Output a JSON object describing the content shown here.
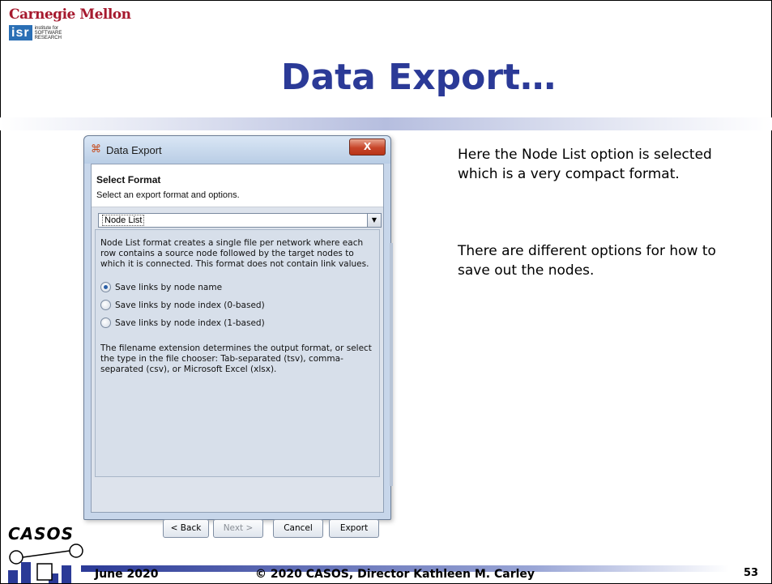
{
  "header": {
    "university": "Carnegie Mellon",
    "institute_abbr": "isr",
    "institute_line1": "institute for",
    "institute_line2": "SOFTWARE",
    "institute_line3": "RESEARCH"
  },
  "title": "Data Export…",
  "dialog": {
    "window_title": "Data Export",
    "close_label": "X",
    "heading": "Select Format",
    "subheading": "Select an export format and options.",
    "format_selected": "Node List",
    "description": "Node List format creates a single file per network where each row contains a source node followed by the target nodes to which it is connected. This format does not contain link values.",
    "options": [
      {
        "label": "Save links by node name",
        "checked": true
      },
      {
        "label": "Save links by node index (0-based)",
        "checked": false
      },
      {
        "label": "Save links by node index (1-based)",
        "checked": false
      }
    ],
    "extension_note": "The filename extension determines the output format, or select the type in the file chooser: Tab-separated (tsv), comma-separated (csv), or Microsoft Excel (xlsx).",
    "buttons": {
      "back": "< Back",
      "next": "Next >",
      "cancel": "Cancel",
      "export": "Export"
    }
  },
  "notes": {
    "paragraph1": "Here the Node List option is selected which is a very compact format.",
    "paragraph2": "There are different options for how to save out the nodes."
  },
  "footer": {
    "logo_text": "CASOS",
    "date": "June 2020",
    "copyright": "© 2020 CASOS, Director Kathleen M. Carley",
    "page": "53"
  }
}
